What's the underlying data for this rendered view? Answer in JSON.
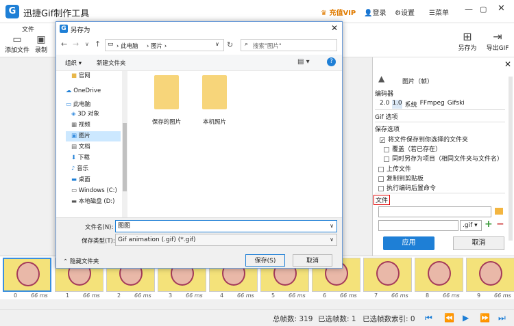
{
  "app": {
    "title": "迅捷Gif制作工具",
    "logo": "G"
  },
  "titlebar": {
    "vip": "充值VIP",
    "login": "登录",
    "settings": "设置",
    "menu": "菜单"
  },
  "toolbar": {
    "file_tab": "文件",
    "add_file": "添加文件",
    "record": "录制",
    "save_as": "另存为",
    "export_gif": "导出GIF"
  },
  "panel": {
    "image_label": "图片（帧）",
    "encoder_title": "编码器",
    "encoders": [
      "2.0",
      "1.0",
      "系统",
      "FFmpeg",
      "Gifski"
    ],
    "selected_encoder": "1.0",
    "gif_options": "Gif 选项",
    "save_options": "保存选项",
    "options": [
      {
        "label": "将文件保存到你选择的文件夹",
        "checked": true
      },
      {
        "label": "覆盖（若已存在）",
        "checked": false
      },
      {
        "label": "同时另存为项目（相同文件夹与文件名）",
        "checked": false
      },
      {
        "label": "上传文件",
        "checked": false
      },
      {
        "label": "复制到剪贴板",
        "checked": false
      },
      {
        "label": "执行编码后置命令",
        "checked": false
      }
    ],
    "file_section": "文件",
    "ext": ".gif",
    "ok": "应用",
    "cancel": "取消"
  },
  "dialog": {
    "title": "另存为",
    "breadcrumb": [
      "此电脑",
      "图片"
    ],
    "search_placeholder": "搜索\"图片\"",
    "organize": "组织 ▾",
    "new_folder": "新建文件夹",
    "nav": [
      "官网",
      "OneDrive",
      "此电脑",
      "3D 对象",
      "视频",
      "图片",
      "文档",
      "下载",
      "音乐",
      "桌面",
      "Windows (C:)",
      "本地磁盘 (D:)"
    ],
    "folders": [
      "保存的图片",
      "本机照片"
    ],
    "filename_label": "文件名(N):",
    "filename_value": "图图",
    "filetype_label": "保存类型(T):",
    "filetype_value": "Gif animation (.gif) (*.gif)",
    "hide_folders": "隐藏文件夹",
    "save": "保存(S)",
    "cancel": "取消"
  },
  "frames": [
    {
      "n": "0",
      "ms": "66 ms"
    },
    {
      "n": "1",
      "ms": "66 ms"
    },
    {
      "n": "2",
      "ms": "66 ms"
    },
    {
      "n": "3",
      "ms": "66 ms"
    },
    {
      "n": "4",
      "ms": "66 ms"
    },
    {
      "n": "5",
      "ms": "66 ms"
    },
    {
      "n": "6",
      "ms": "66 ms"
    },
    {
      "n": "7",
      "ms": "66 ms"
    },
    {
      "n": "8",
      "ms": "66 ms"
    },
    {
      "n": "9",
      "ms": "66 ms"
    }
  ],
  "status": {
    "total": "总帧数: 319",
    "selected": "已选帧数: 1",
    "index": "已选帧数索引: 0"
  },
  "colors": {
    "accent": "#1e7fd6",
    "vip": "#e07b00",
    "highlight_box": "#e00000"
  }
}
